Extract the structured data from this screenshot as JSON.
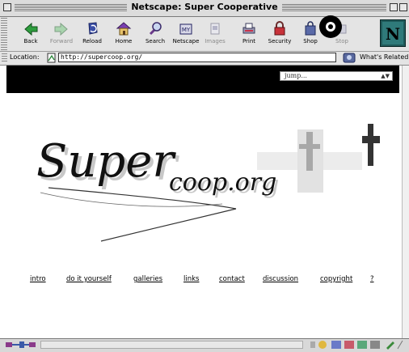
{
  "window": {
    "title": "Netscape: Super Cooperative"
  },
  "toolbar": {
    "buttons": [
      {
        "label": "Back",
        "icon": "back-arrow-icon"
      },
      {
        "label": "Forward",
        "icon": "forward-arrow-icon"
      },
      {
        "label": "Reload",
        "icon": "reload-icon"
      },
      {
        "label": "Home",
        "icon": "home-icon"
      },
      {
        "label": "Search",
        "icon": "search-icon"
      },
      {
        "label": "Netscape",
        "icon": "netscape-icon"
      },
      {
        "label": "Images",
        "icon": "images-icon"
      },
      {
        "label": "Print",
        "icon": "printer-icon"
      },
      {
        "label": "Security",
        "icon": "padlock-icon"
      },
      {
        "label": "Shop",
        "icon": "shop-icon"
      },
      {
        "label": "Stop",
        "icon": "stop-icon"
      }
    ]
  },
  "location": {
    "label": "Location:",
    "url": "http://supercoop.org/",
    "related_label": "What's Related"
  },
  "page": {
    "jump_select": "jump...",
    "logo_main": "Super",
    "logo_sub": "coop.org",
    "nav_links": [
      "intro",
      "do it yourself",
      "galleries",
      "links",
      "contact",
      "discussion",
      "copyright",
      "?"
    ]
  },
  "colors": {
    "band": "#000000",
    "chrome": "#e4e4e4",
    "netscape_teal": "#1f5a5a"
  }
}
